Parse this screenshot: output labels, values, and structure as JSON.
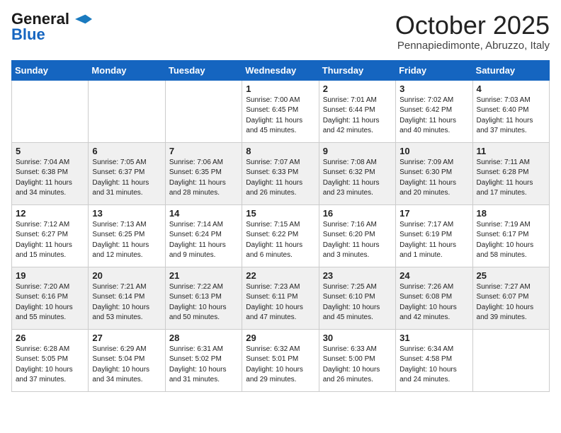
{
  "header": {
    "logo_line1": "General",
    "logo_line2": "Blue",
    "month": "October 2025",
    "location": "Pennapiedimonte, Abruzzo, Italy"
  },
  "columns": [
    "Sunday",
    "Monday",
    "Tuesday",
    "Wednesday",
    "Thursday",
    "Friday",
    "Saturday"
  ],
  "rows": [
    [
      {
        "day": "",
        "sunrise": "",
        "sunset": "",
        "daylight": ""
      },
      {
        "day": "",
        "sunrise": "",
        "sunset": "",
        "daylight": ""
      },
      {
        "day": "",
        "sunrise": "",
        "sunset": "",
        "daylight": ""
      },
      {
        "day": "1",
        "sunrise": "Sunrise: 7:00 AM",
        "sunset": "Sunset: 6:45 PM",
        "daylight": "Daylight: 11 hours and 45 minutes."
      },
      {
        "day": "2",
        "sunrise": "Sunrise: 7:01 AM",
        "sunset": "Sunset: 6:44 PM",
        "daylight": "Daylight: 11 hours and 42 minutes."
      },
      {
        "day": "3",
        "sunrise": "Sunrise: 7:02 AM",
        "sunset": "Sunset: 6:42 PM",
        "daylight": "Daylight: 11 hours and 40 minutes."
      },
      {
        "day": "4",
        "sunrise": "Sunrise: 7:03 AM",
        "sunset": "Sunset: 6:40 PM",
        "daylight": "Daylight: 11 hours and 37 minutes."
      }
    ],
    [
      {
        "day": "5",
        "sunrise": "Sunrise: 7:04 AM",
        "sunset": "Sunset: 6:38 PM",
        "daylight": "Daylight: 11 hours and 34 minutes."
      },
      {
        "day": "6",
        "sunrise": "Sunrise: 7:05 AM",
        "sunset": "Sunset: 6:37 PM",
        "daylight": "Daylight: 11 hours and 31 minutes."
      },
      {
        "day": "7",
        "sunrise": "Sunrise: 7:06 AM",
        "sunset": "Sunset: 6:35 PM",
        "daylight": "Daylight: 11 hours and 28 minutes."
      },
      {
        "day": "8",
        "sunrise": "Sunrise: 7:07 AM",
        "sunset": "Sunset: 6:33 PM",
        "daylight": "Daylight: 11 hours and 26 minutes."
      },
      {
        "day": "9",
        "sunrise": "Sunrise: 7:08 AM",
        "sunset": "Sunset: 6:32 PM",
        "daylight": "Daylight: 11 hours and 23 minutes."
      },
      {
        "day": "10",
        "sunrise": "Sunrise: 7:09 AM",
        "sunset": "Sunset: 6:30 PM",
        "daylight": "Daylight: 11 hours and 20 minutes."
      },
      {
        "day": "11",
        "sunrise": "Sunrise: 7:11 AM",
        "sunset": "Sunset: 6:28 PM",
        "daylight": "Daylight: 11 hours and 17 minutes."
      }
    ],
    [
      {
        "day": "12",
        "sunrise": "Sunrise: 7:12 AM",
        "sunset": "Sunset: 6:27 PM",
        "daylight": "Daylight: 11 hours and 15 minutes."
      },
      {
        "day": "13",
        "sunrise": "Sunrise: 7:13 AM",
        "sunset": "Sunset: 6:25 PM",
        "daylight": "Daylight: 11 hours and 12 minutes."
      },
      {
        "day": "14",
        "sunrise": "Sunrise: 7:14 AM",
        "sunset": "Sunset: 6:24 PM",
        "daylight": "Daylight: 11 hours and 9 minutes."
      },
      {
        "day": "15",
        "sunrise": "Sunrise: 7:15 AM",
        "sunset": "Sunset: 6:22 PM",
        "daylight": "Daylight: 11 hours and 6 minutes."
      },
      {
        "day": "16",
        "sunrise": "Sunrise: 7:16 AM",
        "sunset": "Sunset: 6:20 PM",
        "daylight": "Daylight: 11 hours and 3 minutes."
      },
      {
        "day": "17",
        "sunrise": "Sunrise: 7:17 AM",
        "sunset": "Sunset: 6:19 PM",
        "daylight": "Daylight: 11 hours and 1 minute."
      },
      {
        "day": "18",
        "sunrise": "Sunrise: 7:19 AM",
        "sunset": "Sunset: 6:17 PM",
        "daylight": "Daylight: 10 hours and 58 minutes."
      }
    ],
    [
      {
        "day": "19",
        "sunrise": "Sunrise: 7:20 AM",
        "sunset": "Sunset: 6:16 PM",
        "daylight": "Daylight: 10 hours and 55 minutes."
      },
      {
        "day": "20",
        "sunrise": "Sunrise: 7:21 AM",
        "sunset": "Sunset: 6:14 PM",
        "daylight": "Daylight: 10 hours and 53 minutes."
      },
      {
        "day": "21",
        "sunrise": "Sunrise: 7:22 AM",
        "sunset": "Sunset: 6:13 PM",
        "daylight": "Daylight: 10 hours and 50 minutes."
      },
      {
        "day": "22",
        "sunrise": "Sunrise: 7:23 AM",
        "sunset": "Sunset: 6:11 PM",
        "daylight": "Daylight: 10 hours and 47 minutes."
      },
      {
        "day": "23",
        "sunrise": "Sunrise: 7:25 AM",
        "sunset": "Sunset: 6:10 PM",
        "daylight": "Daylight: 10 hours and 45 minutes."
      },
      {
        "day": "24",
        "sunrise": "Sunrise: 7:26 AM",
        "sunset": "Sunset: 6:08 PM",
        "daylight": "Daylight: 10 hours and 42 minutes."
      },
      {
        "day": "25",
        "sunrise": "Sunrise: 7:27 AM",
        "sunset": "Sunset: 6:07 PM",
        "daylight": "Daylight: 10 hours and 39 minutes."
      }
    ],
    [
      {
        "day": "26",
        "sunrise": "Sunrise: 6:28 AM",
        "sunset": "Sunset: 5:05 PM",
        "daylight": "Daylight: 10 hours and 37 minutes."
      },
      {
        "day": "27",
        "sunrise": "Sunrise: 6:29 AM",
        "sunset": "Sunset: 5:04 PM",
        "daylight": "Daylight: 10 hours and 34 minutes."
      },
      {
        "day": "28",
        "sunrise": "Sunrise: 6:31 AM",
        "sunset": "Sunset: 5:02 PM",
        "daylight": "Daylight: 10 hours and 31 minutes."
      },
      {
        "day": "29",
        "sunrise": "Sunrise: 6:32 AM",
        "sunset": "Sunset: 5:01 PM",
        "daylight": "Daylight: 10 hours and 29 minutes."
      },
      {
        "day": "30",
        "sunrise": "Sunrise: 6:33 AM",
        "sunset": "Sunset: 5:00 PM",
        "daylight": "Daylight: 10 hours and 26 minutes."
      },
      {
        "day": "31",
        "sunrise": "Sunrise: 6:34 AM",
        "sunset": "Sunset: 4:58 PM",
        "daylight": "Daylight: 10 hours and 24 minutes."
      },
      {
        "day": "",
        "sunrise": "",
        "sunset": "",
        "daylight": ""
      }
    ]
  ]
}
